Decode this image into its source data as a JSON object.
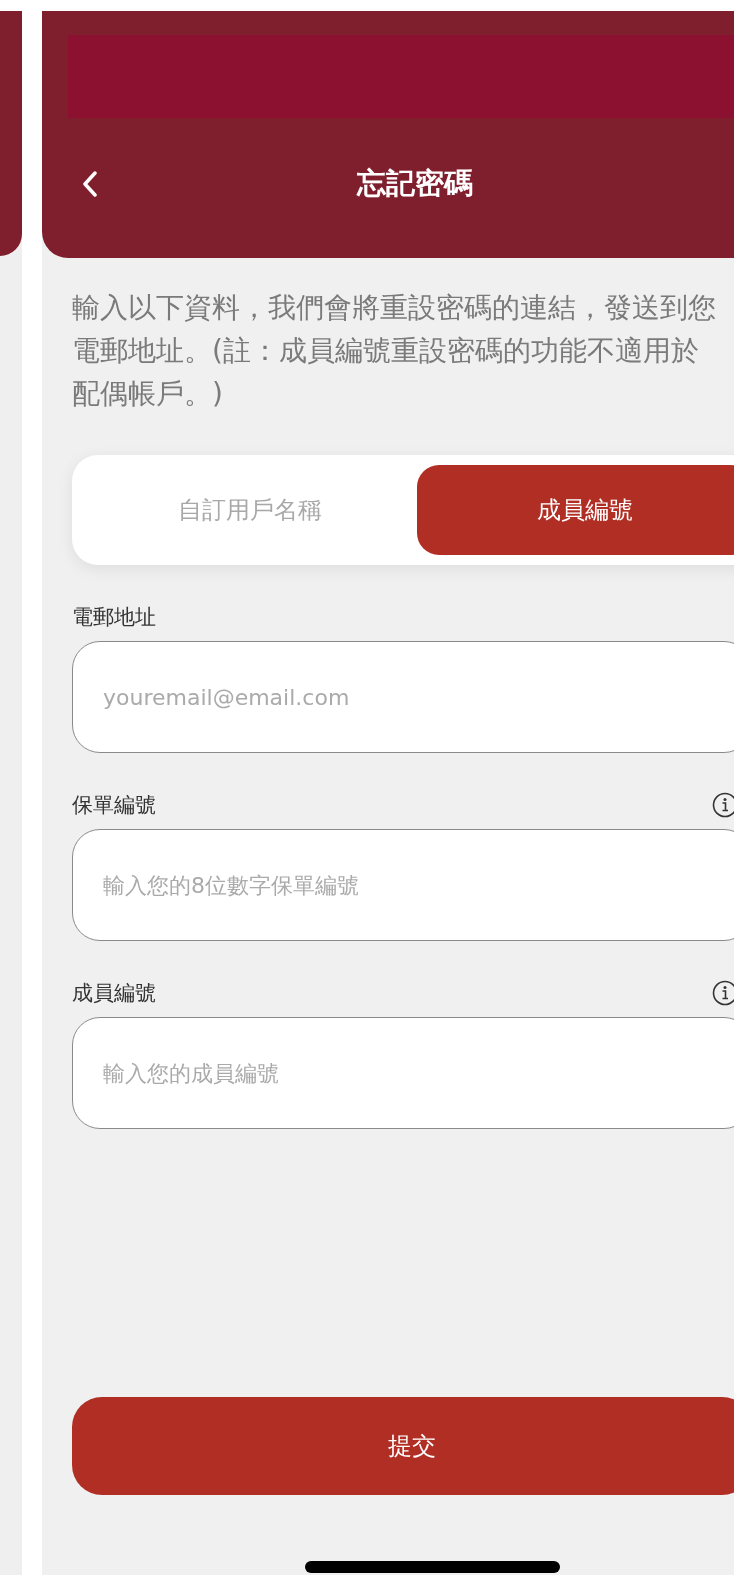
{
  "header": {
    "title": "忘記密碼"
  },
  "description": "輸入以下資料，我們會將重設密碼的連結，發送到您電郵地址。(註：成員編號重設密碼的功能不適用於配偶帳戶。)",
  "tabs": [
    {
      "label": "自訂用戶名稱",
      "selected": false
    },
    {
      "label": "成員編號",
      "selected": true
    }
  ],
  "fields": [
    {
      "label": "電郵地址",
      "placeholder": "youremail@email.com",
      "info": false
    },
    {
      "label": "保單編號",
      "placeholder": "輸入您的8位數字保單編號",
      "info": true
    },
    {
      "label": "成員編號",
      "placeholder": "輸入您的成員編號",
      "info": true
    }
  ],
  "submit": {
    "label": "提交"
  }
}
